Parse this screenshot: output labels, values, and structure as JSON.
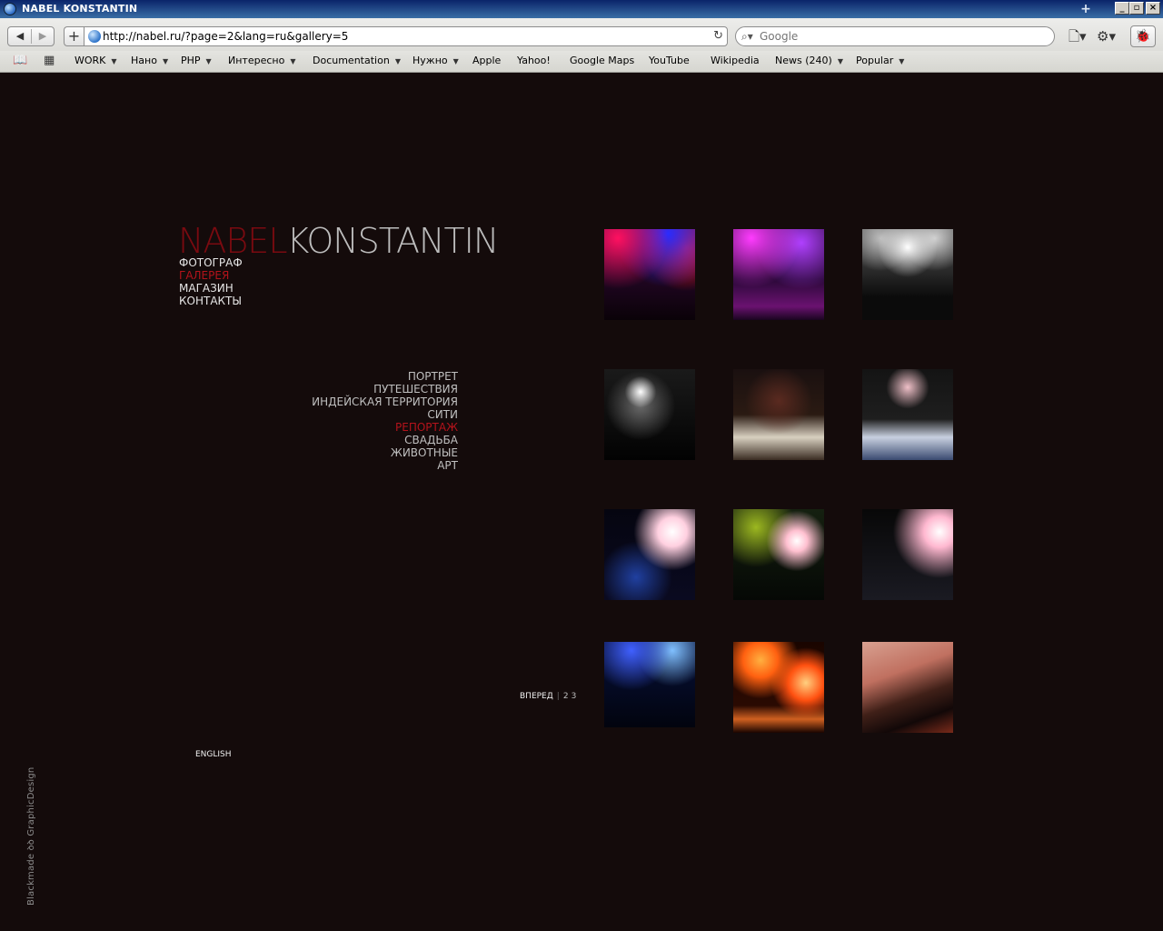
{
  "window": {
    "title": "NABEL KONSTANTIN"
  },
  "toolbar": {
    "url": "http://nabel.ru/?page=2&lang=ru&gallery=5",
    "search_placeholder": "Google",
    "back_icon": "◀",
    "forward_icon": "▶",
    "add_icon": "+",
    "reload_icon": "↻"
  },
  "bookmarks": [
    {
      "label": "WORK",
      "menu": true
    },
    {
      "label": "Нано",
      "menu": true
    },
    {
      "label": "PHP",
      "menu": true
    },
    {
      "label": "Интересно",
      "menu": true
    },
    {
      "label": "Documentation",
      "menu": true
    },
    {
      "label": "Нужно",
      "menu": true
    },
    {
      "label": "Apple",
      "menu": false
    },
    {
      "label": "Yahoo!",
      "menu": false
    },
    {
      "label": "Google Maps",
      "menu": false
    },
    {
      "label": "YouTube",
      "menu": false
    },
    {
      "label": "Wikipedia",
      "menu": false
    },
    {
      "label": "News (240)",
      "menu": true
    },
    {
      "label": "Popular",
      "menu": true
    }
  ],
  "site": {
    "logo_first": "NABEL",
    "logo_last": "KONSTANTIN",
    "main_nav": [
      {
        "label": "ФОТОГРАФ",
        "active": false
      },
      {
        "label": "ГАЛЕРЕЯ",
        "active": true
      },
      {
        "label": "МАГАЗИН",
        "active": false
      },
      {
        "label": "КОНТАКТЫ",
        "active": false
      }
    ],
    "gallery_nav": [
      {
        "label": "ПОРТРЕТ",
        "active": false
      },
      {
        "label": "ПУТЕШЕСТВИЯ",
        "active": false
      },
      {
        "label": "ИНДЕЙСКАЯ ТЕРРИТОРИЯ",
        "active": false
      },
      {
        "label": "СИТИ",
        "active": false
      },
      {
        "label": "РЕПОРТАЖ",
        "active": true
      },
      {
        "label": "СВАДЬБА",
        "active": false
      },
      {
        "label": "ЖИВОТНЫЕ",
        "active": false
      },
      {
        "label": "АРТ",
        "active": false
      }
    ],
    "pager": {
      "next": "ВПЕРЕД",
      "pages": [
        "2",
        "3"
      ]
    },
    "language_link": "ENGLISH",
    "credit": "Blackmade ꝺꝺ GraphicDesign"
  },
  "colors": {
    "background": "#140b0b",
    "accent": "#b3131b",
    "logo_first": "#7a0a10",
    "logo_last": "#bcbcbc"
  }
}
